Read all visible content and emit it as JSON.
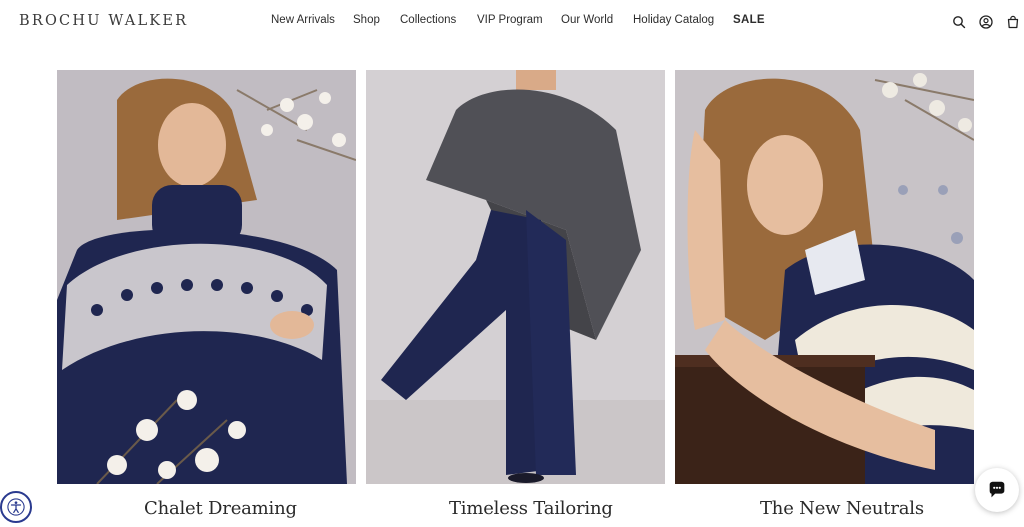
{
  "brand": {
    "logo": "BROCHU WALKER"
  },
  "nav": {
    "items": [
      {
        "label": "New Arrivals"
      },
      {
        "label": "Shop"
      },
      {
        "label": "Collections"
      },
      {
        "label": "VIP Program"
      },
      {
        "label": "Our World"
      },
      {
        "label": "Holiday Catalog"
      },
      {
        "label": "SALE"
      }
    ]
  },
  "header_icons": [
    "search-icon",
    "account-icon",
    "cart-icon"
  ],
  "collections": [
    {
      "title": "Chalet Dreaming"
    },
    {
      "title": "Timeless Tailoring"
    },
    {
      "title": "The New Neutrals"
    }
  ],
  "widgets": {
    "accessibility": "accessibility-icon",
    "chat": "chat-icon"
  },
  "colors": {
    "navy": "#1f2650",
    "text": "#2a2a2a",
    "a11y_ring": "#2a3a8f"
  }
}
